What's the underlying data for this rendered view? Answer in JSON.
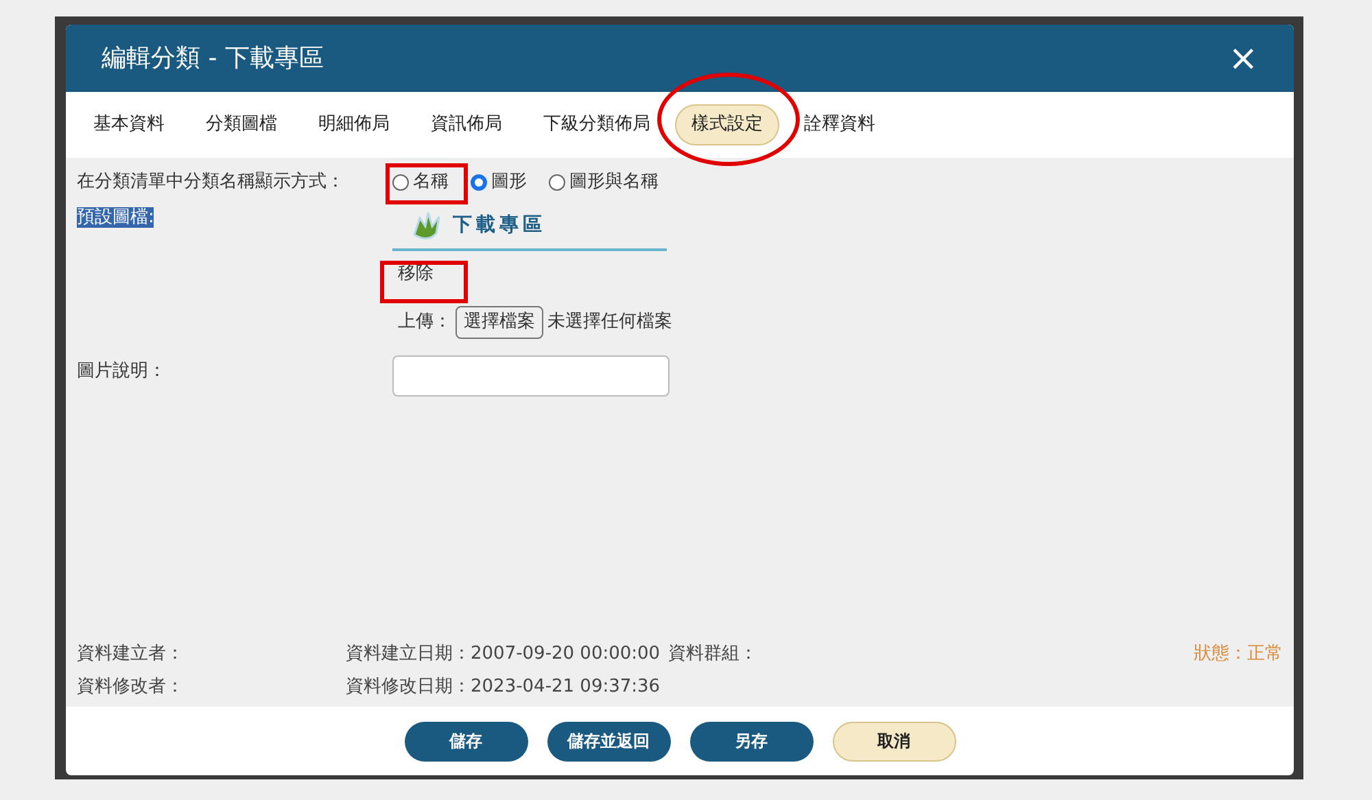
{
  "dialog": {
    "title": "編輯分類 - 下載專區",
    "close": "×"
  },
  "tabs": [
    {
      "label": "基本資料",
      "selected": false
    },
    {
      "label": "分類圖檔",
      "selected": false
    },
    {
      "label": "明細佈局",
      "selected": false
    },
    {
      "label": "資訊佈局",
      "selected": false
    },
    {
      "label": "下級分類佈局",
      "selected": false
    },
    {
      "label": "樣式設定",
      "selected": true
    },
    {
      "label": "詮釋資料",
      "selected": false
    }
  ],
  "display_mode": {
    "label": "在分類清單中分類名稱顯示方式：",
    "options": [
      {
        "label": "名稱",
        "selected": false
      },
      {
        "label": "圖形",
        "selected": true
      },
      {
        "label": "圖形與名稱",
        "selected": false
      }
    ]
  },
  "default_image": {
    "label": "預設圖檔:",
    "logo_text": "下載專區",
    "remove": "移除",
    "upload_label": "上傳：",
    "choose_button": "選擇檔案",
    "no_file": "未選擇任何檔案"
  },
  "image_caption": {
    "label": "圖片說明："
  },
  "meta": {
    "creator": "資料建立者：",
    "created_date_label": "資料建立日期：",
    "created_date": "2007-09-20 00:00:00",
    "group_label": "資料群組：",
    "modifier": "資料修改者：",
    "modified_date_label": "資料修改日期：",
    "modified_date": "2023-04-21 09:37:36",
    "status": "狀態：正常"
  },
  "buttons": [
    {
      "label": "儲存",
      "kind": "primary"
    },
    {
      "label": "儲存並返回",
      "kind": "primary"
    },
    {
      "label": "另存",
      "kind": "primary"
    },
    {
      "label": "取消",
      "kind": "secondary"
    }
  ]
}
